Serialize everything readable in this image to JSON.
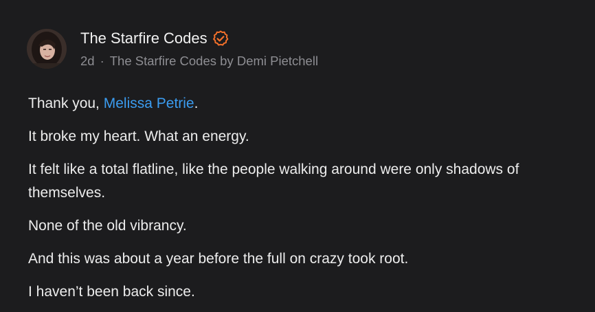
{
  "author": {
    "name": "The Starfire Codes",
    "verified_icon": "verified-badge-icon",
    "verified_color": "#f4702a"
  },
  "meta": {
    "time": "2d",
    "separator": "·",
    "publication": "The Starfire Codes by Demi Pietchell"
  },
  "comment": {
    "line1_prefix": "Thank you, ",
    "mention": "Melissa Petrie",
    "line1_suffix": ".",
    "paragraphs": [
      "It broke my heart. What an energy.",
      "It felt like a total flatline, like the people walking around were only shadows of themselves.",
      "None of the old vibrancy.",
      "And this was about a year before the full on crazy took root.",
      "I haven’t been back since."
    ]
  },
  "colors": {
    "background": "#1c1c1e",
    "text": "#ededed",
    "muted": "#8e8e93",
    "mention": "#3b9cf0"
  }
}
